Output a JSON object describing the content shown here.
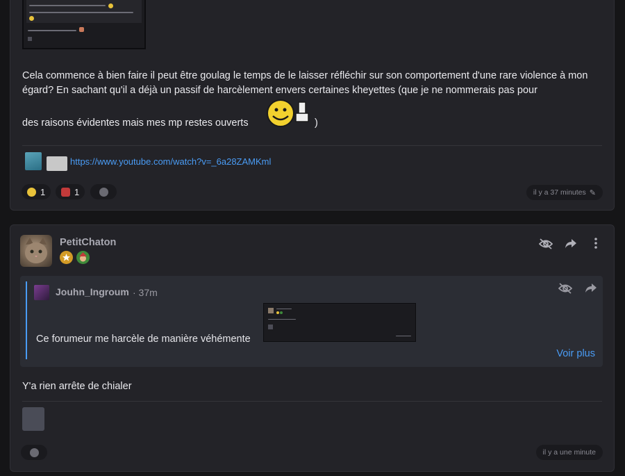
{
  "post1": {
    "body_line1": "Cela commence à bien faire il peut être goulag le temps de le laisser réfléchir sur son comportement d'une rare violence à mon égard? En sachant qu'il a déjà un passif de harcèlement envers certaines kheyettes (que je ne nommerais pas pour",
    "body_line3": "des raisons évidentes mais mes mp restes ouverts",
    "body_close": ")",
    "signature_link": "https://www.youtube.com/watch?v=_6a28ZAMKml",
    "reactions": [
      {
        "emoji": "smiley-emoji",
        "count": "1"
      },
      {
        "emoji": "figure-emoji",
        "count": "1"
      }
    ],
    "time": "il y a 37 minutes"
  },
  "post2": {
    "username": "PetitChaton",
    "quote": {
      "username": "Jouhn_Ingroum",
      "time": "· 37m",
      "text": "Ce forumeur me harcèle de manière véhémente",
      "voir_plus": "Voir plus"
    },
    "body": "Y'a rien arrête de chialer",
    "time": "il y a une minute"
  },
  "colors": {
    "background": "#151517",
    "card": "#232328",
    "link": "#4a9cf5",
    "quote_bg": "#2b2d34"
  }
}
